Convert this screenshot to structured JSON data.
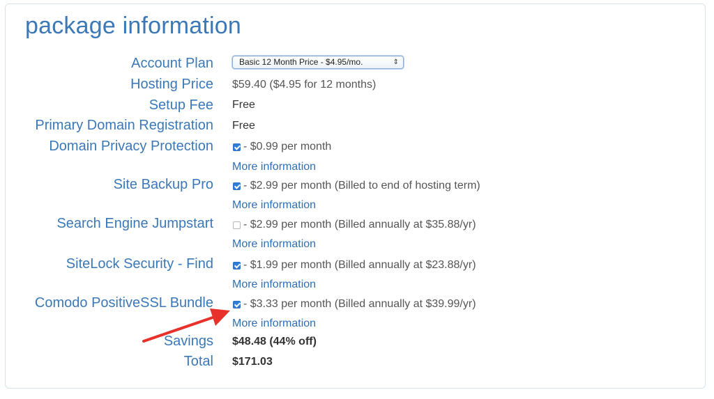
{
  "section_title": "package information",
  "rows": {
    "account_plan": {
      "label": "Account Plan",
      "select_value": "Basic 12 Month Price - $4.95/mo.",
      "select_arrows": "⇕"
    },
    "hosting_price": {
      "label": "Hosting Price",
      "value": "$59.40  ($4.95 for 12 months)"
    },
    "setup_fee": {
      "label": "Setup Fee",
      "value": "Free"
    },
    "primary_domain": {
      "label": "Primary Domain Registration",
      "value": "Free"
    },
    "domain_privacy": {
      "label": "Domain Privacy Protection",
      "checked": true,
      "text": " - $0.99 per month",
      "more": "More information"
    },
    "site_backup": {
      "label": "Site Backup Pro",
      "checked": true,
      "text": " - $2.99 per month (Billed to end of hosting term)",
      "more": "More information"
    },
    "search_engine": {
      "label": "Search Engine Jumpstart",
      "checked": false,
      "text": " - $2.99 per month (Billed annually at $35.88/yr)",
      "more": "More information"
    },
    "sitelock": {
      "label": "SiteLock Security - Find",
      "checked": true,
      "text": " - $1.99 per month (Billed annually at $23.88/yr)",
      "more": "More information"
    },
    "comodo": {
      "label": "Comodo PositiveSSL Bundle",
      "checked": true,
      "text": " - $3.33 per month (Billed annually at $39.99/yr)",
      "more": "More information"
    },
    "savings": {
      "label": "Savings",
      "value": "$48.48 (44% off)"
    },
    "total": {
      "label": "Total",
      "value": "$171.03"
    }
  },
  "colors": {
    "label_blue": "#3b78b8",
    "link_blue": "#2f6fb5",
    "checkbox_blue": "#2f7fd8",
    "annotation_arrow": "#e8312a"
  }
}
